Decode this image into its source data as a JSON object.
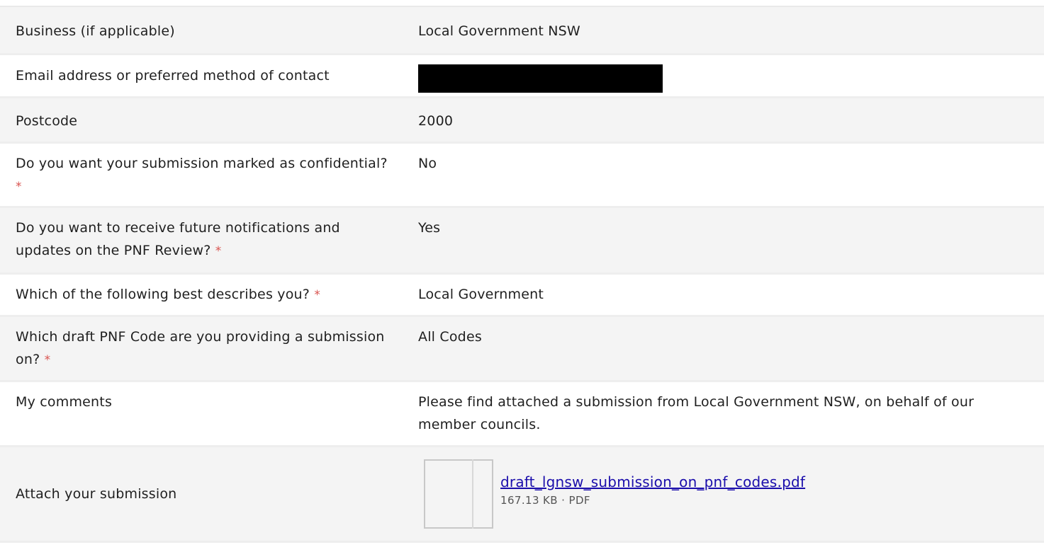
{
  "rows": [
    {
      "label": "Business (if applicable)",
      "required": false,
      "value": "Local Government NSW"
    },
    {
      "label": "Email address or preferred method of contact",
      "required": false,
      "value": ""
    },
    {
      "label": "Postcode",
      "required": false,
      "value": "2000"
    },
    {
      "label": "Do you want your submission marked as confidential?",
      "required": true,
      "value": "No"
    },
    {
      "label": "Do you want to receive future notifications and updates on the PNF Review?",
      "required": true,
      "value": "Yes"
    },
    {
      "label": "Which of the following best describes you?",
      "required": true,
      "value": "Local Government"
    },
    {
      "label": "Which draft PNF Code are you providing a submission on?",
      "required": true,
      "value": "All Codes"
    },
    {
      "label": "My comments",
      "required": false,
      "value": "Please find attached a submission from Local Government NSW, on behalf of our member councils."
    },
    {
      "label": "Attach your submission",
      "required": false
    }
  ],
  "required_marker": "*",
  "attachment": {
    "filename": "draft_lgnsw_submission_on_pnf_codes.pdf",
    "size": "167.13 KB",
    "separator": "·",
    "type": "PDF"
  }
}
